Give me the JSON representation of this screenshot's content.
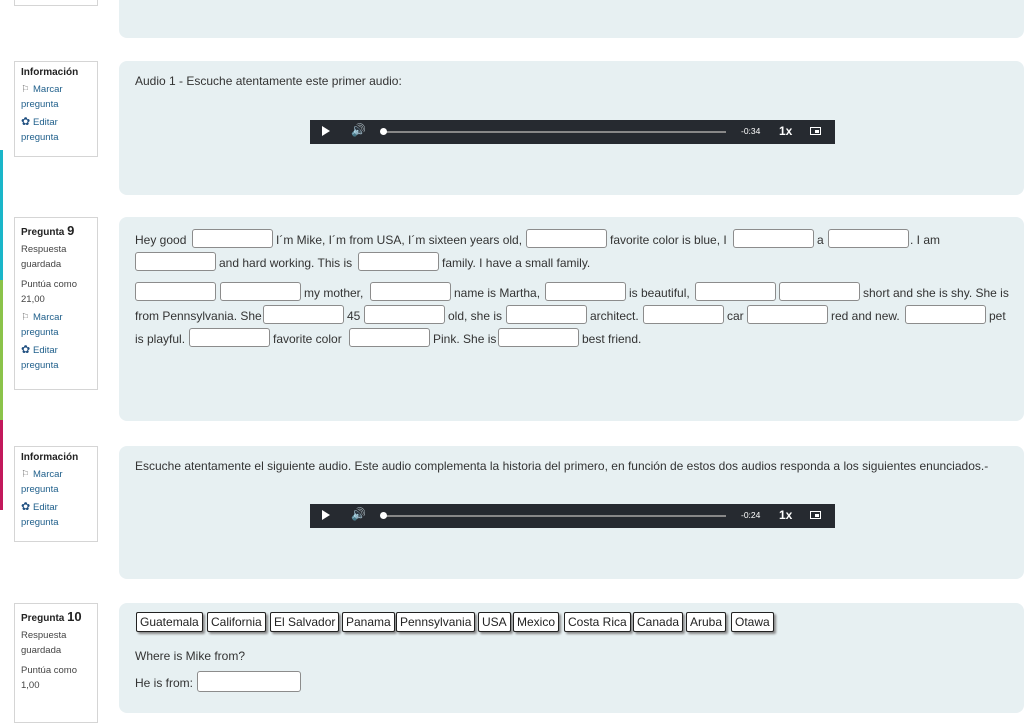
{
  "q_info1": {
    "title": "Información",
    "flag": "Marcar pregunta",
    "edit": "Editar pregunta"
  },
  "q9": {
    "word": "Pregunta",
    "number": "9",
    "status": "Respuesta guardada",
    "score": "Puntúa como 21,00",
    "flag": "Marcar pregunta",
    "edit": "Editar pregunta"
  },
  "q_info2": {
    "title": "Información",
    "flag": "Marcar pregunta",
    "edit": "Editar pregunta"
  },
  "q10": {
    "word": "Pregunta",
    "number": "10",
    "status": "Respuesta guardada",
    "score": "Puntúa como 1,00"
  },
  "audio1": {
    "text": "Audio 1 - Escuche atentamente este primer audio:",
    "time": "-0:34",
    "speed": "1x"
  },
  "audio2": {
    "text": "Escuche atentamente el siguiente audio. Este audio complementa la historia del primero, en función de estos dos audios responda a los siguientes enunciados.-",
    "time": "-0:24",
    "speed": "1x"
  },
  "cloze": {
    "seg1": "Hey good",
    "seg2": "I´m Mike, I´m from USA, I´m sixteen years old,",
    "seg3": "favorite color is blue, I",
    "seg4": "a",
    "seg5": ". I am",
    "seg6": "and hard working. This is",
    "seg7": "family. I have a small family.",
    "seg8": "my mother,",
    "seg9": "name is Martha,",
    "seg10": "is beautiful,",
    "seg11": "short and she is shy. She is",
    "seg12": "from Pennsylvania. She",
    "seg13": "45",
    "seg14": "old, she is",
    "seg15": "architect.",
    "seg16": "car",
    "seg17": "red and new.",
    "seg18": "pet",
    "seg19": "is playful.",
    "seg20": "favorite color",
    "seg21": "Pink. She is",
    "seg22": "best friend."
  },
  "options": [
    "Guatemala",
    "California",
    "El Salvador",
    "Panama",
    "Pennsylvania",
    "USA",
    "Mexico",
    "Costa Rica",
    "Canada",
    "Aruba",
    "Otawa"
  ],
  "q10_question": "Where is Mike from?",
  "q10_answer_label": "He is from:",
  "colors": {
    "panel": "#e7f0f2",
    "link": "#1f5f8b",
    "player": "#262a30"
  },
  "icons": {
    "flag": "flag-icon",
    "edit": "gear-icon",
    "play": "play-icon",
    "volume": "volume-icon",
    "pip": "picture-in-picture-icon"
  }
}
